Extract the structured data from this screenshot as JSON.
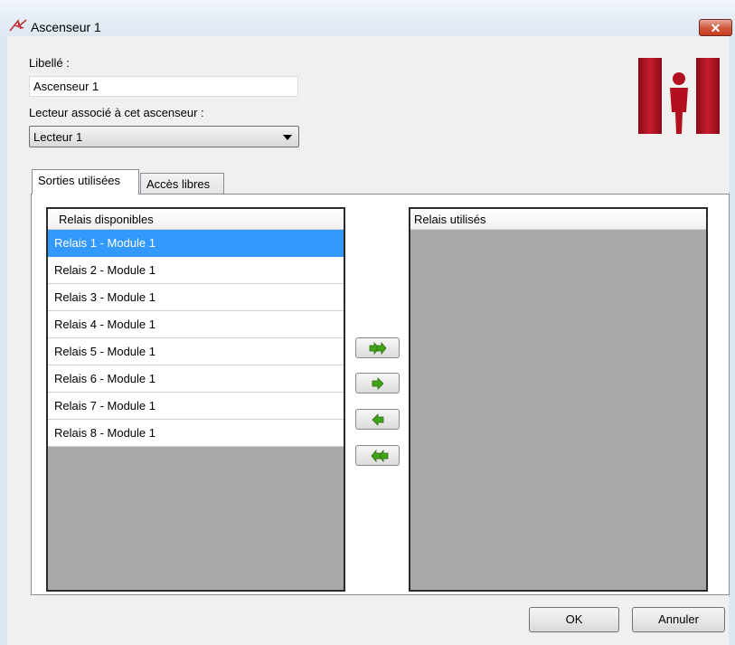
{
  "window": {
    "title": "Ascenseur 1",
    "close_glyph": "✕",
    "icon": "app-logo-icon"
  },
  "form": {
    "name_label": "Libellé :",
    "name_value": "Ascenseur 1",
    "reader_label": "Lecteur associé à cet ascenseur :",
    "reader_selected": "Lecteur 1"
  },
  "tabs": [
    {
      "label": "Sorties utilisées",
      "active": true
    },
    {
      "label": "Accès libres",
      "active": false
    }
  ],
  "available_list": {
    "header": "Relais disponibles",
    "items": [
      "Relais 1 - Module 1",
      "Relais 2 - Module 1",
      "Relais 3 - Module 1",
      "Relais 4 - Module 1",
      "Relais 5 - Module 1",
      "Relais 6 - Module 1",
      "Relais 7 - Module 1",
      "Relais 8 - Module 1"
    ],
    "selected_index": 0
  },
  "used_list": {
    "header": "Relais utilisés",
    "items": []
  },
  "move_buttons": [
    "move-all-right-icon",
    "move-right-icon",
    "move-left-icon",
    "move-all-left-icon"
  ],
  "buttons": {
    "ok": "OK",
    "cancel": "Annuler"
  },
  "colors": {
    "selection": "#3399ff",
    "logo_red": "#b3101f",
    "arrow_green": "#3ea315"
  }
}
